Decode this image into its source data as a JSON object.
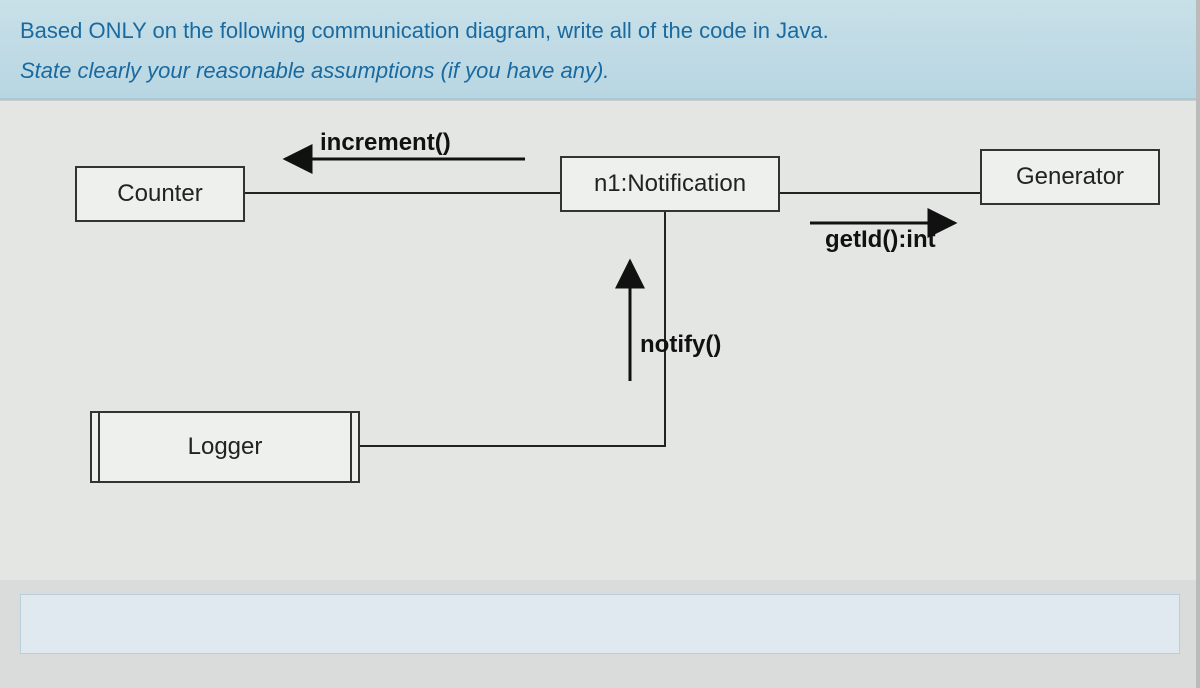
{
  "question": {
    "line1": "Based ONLY on the following communication diagram, write all of the code in Java.",
    "line2": "State clearly your reasonable assumptions (if you have any)."
  },
  "diagram": {
    "nodes": {
      "counter": {
        "label": "Counter"
      },
      "notification": {
        "label": "n1:Notification"
      },
      "generator": {
        "label": "Generator"
      },
      "logger": {
        "label": "Logger"
      }
    },
    "messages": {
      "increment": {
        "label": "increment()",
        "from": "notification",
        "to": "counter"
      },
      "getId": {
        "label": "getId():int",
        "from": "notification",
        "to": "generator"
      },
      "notify": {
        "label": "notify()",
        "from": "logger",
        "to": "notification"
      }
    }
  }
}
